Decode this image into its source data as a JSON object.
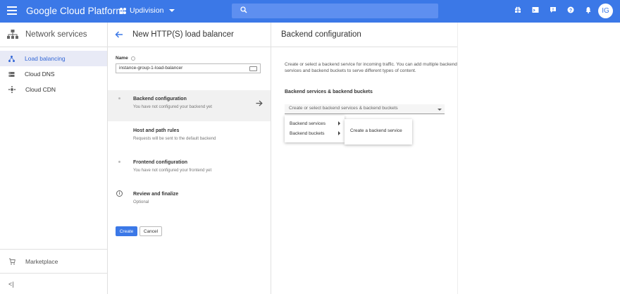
{
  "topbar": {
    "brand": "Google Cloud Platform",
    "project": "Updivision",
    "icons": [
      "gift-icon",
      "terminal-icon",
      "notification-alert-icon",
      "help-icon",
      "bell-icon"
    ],
    "avatar": "IG"
  },
  "leftnav": {
    "title": "Network services",
    "items": [
      {
        "label": "Load balancing",
        "icon": "load-balancing-icon",
        "active": true
      },
      {
        "label": "Cloud DNS",
        "icon": "dns-icon",
        "active": false
      },
      {
        "label": "Cloud CDN",
        "icon": "cdn-icon",
        "active": false
      }
    ],
    "marketplace": "Marketplace",
    "collapse": "<|"
  },
  "midpanel": {
    "title": "New HTTP(S) load balancer",
    "name_label": "Name",
    "name_value": "instance-group-1-load-balancer",
    "steps": [
      {
        "title": "Backend configuration",
        "subtitle": "You have not configured your backend yet"
      },
      {
        "title": "Host and path rules",
        "subtitle": "Requests will be sent to the default backend"
      },
      {
        "title": "Frontend configuration",
        "subtitle": "You have not configured your frontend yet"
      },
      {
        "title": "Review and finalize",
        "subtitle": "Optional"
      }
    ],
    "create_label": "Create",
    "cancel_label": "Cancel"
  },
  "rightpanel": {
    "title": "Backend configuration",
    "description": "Create or select a backend service for incoming traffic. You can add multiple backend services and backend buckets to serve different types of content.",
    "subhead": "Backend services & backend buckets",
    "select_placeholder": "Create or select backend services & backend buckets",
    "menu": [
      "Backend services",
      "Backend buckets"
    ],
    "submenu": [
      "Create a backend service"
    ]
  },
  "colors": {
    "topbar": "#3b78e7",
    "accent": "#3367d6"
  }
}
